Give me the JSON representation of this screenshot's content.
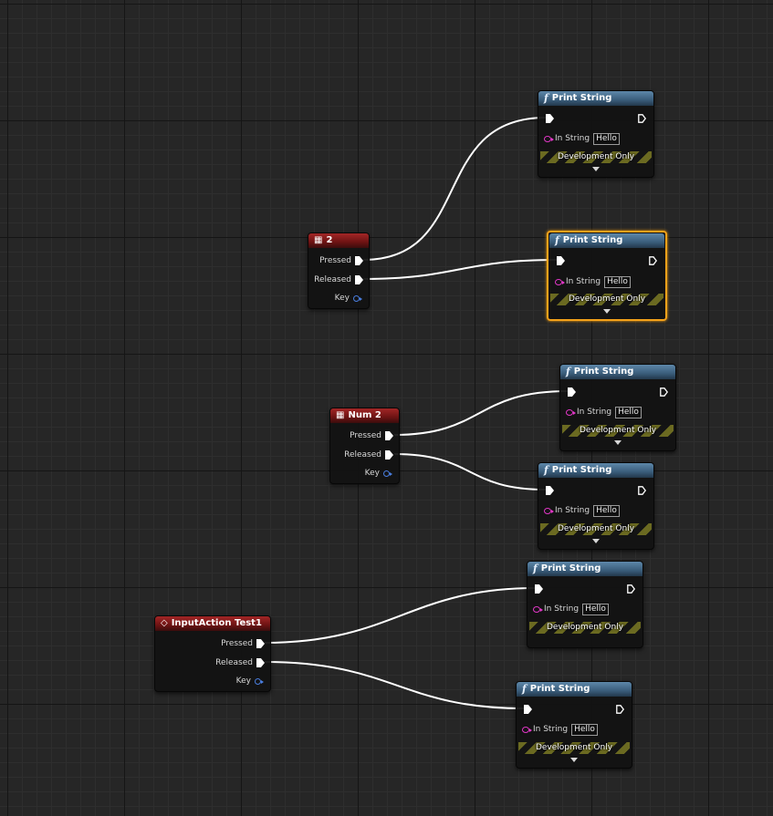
{
  "graph": {
    "nodes": [
      {
        "id": "evt_2",
        "type": "event",
        "title": "2",
        "icon": "keyboard-icon",
        "pins": {
          "pressed": "Pressed",
          "released": "Released",
          "key": "Key"
        }
      },
      {
        "id": "evt_num2",
        "type": "event",
        "title": "Num 2",
        "icon": "keyboard-icon",
        "pins": {
          "pressed": "Pressed",
          "released": "Released",
          "key": "Key"
        }
      },
      {
        "id": "evt_ia",
        "type": "event",
        "title": "InputAction Test1",
        "icon": "input-action-icon",
        "pins": {
          "pressed": "Pressed",
          "released": "Released",
          "key": "Key"
        }
      },
      {
        "id": "ps1",
        "type": "function",
        "title": "Print String",
        "in_string_label": "In String",
        "in_string_value": "Hello",
        "dev_label": "Development Only",
        "selected": false
      },
      {
        "id": "ps2",
        "type": "function",
        "title": "Print String",
        "in_string_label": "In String",
        "in_string_value": "Hello",
        "dev_label": "Development Only",
        "selected": true
      },
      {
        "id": "ps3",
        "type": "function",
        "title": "Print String",
        "in_string_label": "In String",
        "in_string_value": "Hello",
        "dev_label": "Development Only",
        "selected": false
      },
      {
        "id": "ps4",
        "type": "function",
        "title": "Print String",
        "in_string_label": "In String",
        "in_string_value": "Hello",
        "dev_label": "Development Only",
        "selected": false
      },
      {
        "id": "ps5",
        "type": "function",
        "title": "Print String",
        "in_string_label": "In String",
        "in_string_value": "Hello",
        "dev_label": "Development Only",
        "selected": false
      },
      {
        "id": "ps6",
        "type": "function",
        "title": "Print String",
        "in_string_label": "In String",
        "in_string_value": "Hello",
        "dev_label": "Development Only",
        "selected": false
      }
    ],
    "connections": [
      {
        "from": "evt_2.pressed",
        "to": "ps1.exec_in"
      },
      {
        "from": "evt_2.released",
        "to": "ps2.exec_in"
      },
      {
        "from": "evt_num2.pressed",
        "to": "ps3.exec_in"
      },
      {
        "from": "evt_num2.released",
        "to": "ps4.exec_in"
      },
      {
        "from": "evt_ia.pressed",
        "to": "ps5.exec_in"
      },
      {
        "from": "evt_ia.released",
        "to": "ps6.exec_in"
      }
    ],
    "colors": {
      "background": "#262626",
      "event_header": "#a32626",
      "function_header": "#3a5d7b",
      "exec_wire": "#ffffff",
      "string_pin": "#e437c9",
      "key_pin": "#4a7ee0",
      "selection": "#f5a21a"
    }
  }
}
